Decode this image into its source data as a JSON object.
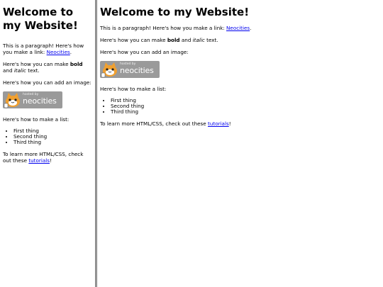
{
  "page": {
    "title": "Welcome to my Website!",
    "paragraph_link_prefix": "This is a paragraph! Here's how you make a link: ",
    "link_text": "Neocities",
    "link_suffix": ".",
    "bold_prefix": "Here's how you can make ",
    "bold_word": "bold",
    "bold_middle": " and ",
    "italic_word": "italic",
    "italic_suffix": " text.",
    "image_intro": "Here's how you can add an image:",
    "badge": {
      "hosted_text": "hosted by",
      "name_text": "neocities"
    },
    "list_intro": "Here's how to make a list:",
    "list_items": [
      "First thing",
      "Second thing",
      "Third thing"
    ],
    "learn_prefix": "To learn more HTML/CSS, check out these ",
    "tutorials_link": "tutorials",
    "learn_suffix": "!"
  },
  "colors": {
    "link": "#0000ee",
    "badge_bg": "#9a9a9a",
    "divider": "#b4b4b4"
  },
  "icons": {
    "badge_mascot": "neocities-cat-icon"
  }
}
